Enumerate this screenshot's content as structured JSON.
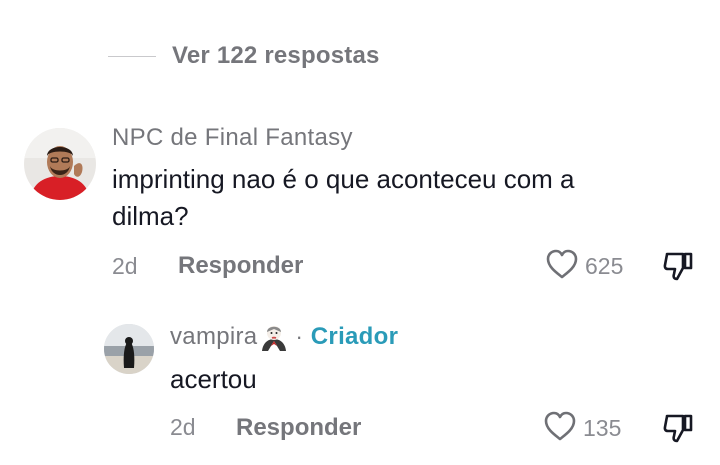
{
  "thread": {
    "view_replies_label": "Ver 122 respostas"
  },
  "comments": [
    {
      "username": "NPC de Final Fantasy",
      "text": "imprinting nao é o que aconteceu com a dilma?",
      "date": "2d",
      "reply_label": "Responder",
      "likes": "625",
      "avatar": "avatar-photo-man-red-shirt"
    },
    {
      "username": "vampira",
      "emoji": "vampire-emoji",
      "separator": "·",
      "badge": "Criador",
      "text": "acertou",
      "date": "2d",
      "reply_label": "Responder",
      "likes": "135",
      "avatar": "avatar-photo-woman-beach"
    }
  ],
  "icons": {
    "like": "heart-outline-icon",
    "dislike": "thumbs-down-outline-icon"
  },
  "colors": {
    "text": "#161823",
    "muted": "#75767b",
    "creator_badge": "#2a9bb8"
  }
}
